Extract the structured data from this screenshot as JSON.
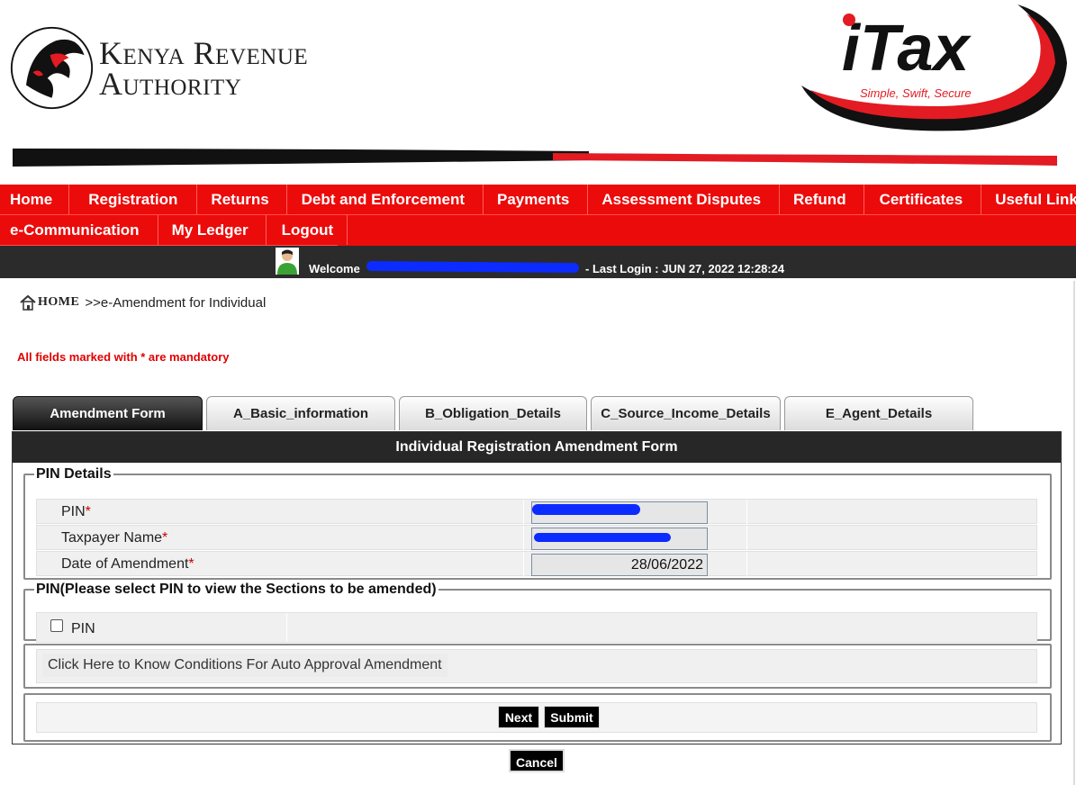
{
  "header": {
    "org_line1": "Kenya Revenue",
    "org_line2": "Authority",
    "product_name": "iTax",
    "tagline": "Simple, Swift, Secure"
  },
  "nav": {
    "row1": [
      "Home",
      "Registration",
      "Returns",
      "Debt and Enforcement",
      "Payments",
      "Assessment Disputes",
      "Refund",
      "Certificates",
      "Useful Links"
    ],
    "row2": [
      "e-Communication",
      "My Ledger",
      "Logout"
    ]
  },
  "welcome": {
    "label": "Welcome",
    "last_login": "- Last Login : JUN 27, 2022 12:28:24"
  },
  "breadcrumb": {
    "home": "HOME",
    "current": ">>e-Amendment for Individual"
  },
  "mandatory_note": "All fields marked with * are mandatory",
  "tabs": [
    "Amendment Form",
    "A_Basic_information",
    "B_Obligation_Details",
    "C_Source_Income_Details",
    "E_Agent_Details"
  ],
  "form": {
    "title": "Individual Registration Amendment Form",
    "pin_details": {
      "legend": "PIN Details",
      "pin_label": "PIN",
      "taxpayer_label": "Taxpayer Name",
      "date_label": "Date of Amendment",
      "required_mark": "*",
      "date_value": "28/06/2022"
    },
    "select_section": {
      "legend": "PIN(Please select PIN to view the Sections to be amended)",
      "checkbox_label": "PIN",
      "checked": false
    },
    "conditions_link": "Click Here to Know Conditions For Auto Approval Amendment",
    "buttons": {
      "next": "Next",
      "submit": "Submit",
      "cancel": "Cancel"
    }
  },
  "colors": {
    "brand_red": "#ec0b0b",
    "dark_bar": "#2b2b2b",
    "redaction_blue": "#0b2bff"
  }
}
